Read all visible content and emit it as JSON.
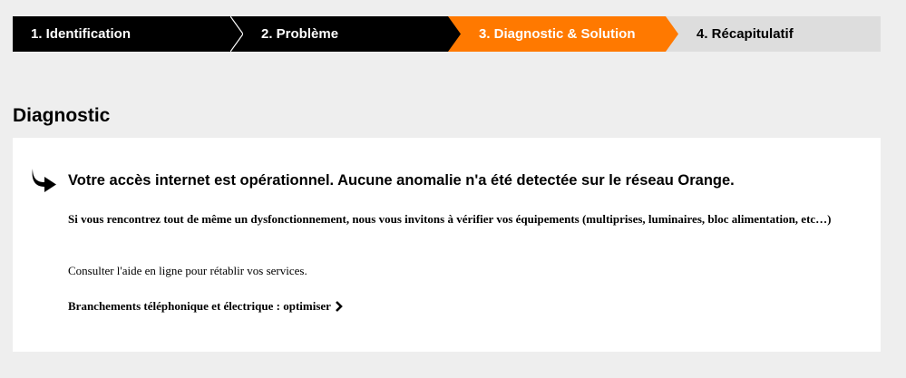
{
  "stepper": {
    "steps": [
      {
        "label": "1. Identification",
        "state": "done"
      },
      {
        "label": "2. Problème",
        "state": "done"
      },
      {
        "label": "3. Diagnostic & Solution",
        "state": "active"
      },
      {
        "label": "4. Récapitulatif",
        "state": "upcoming"
      }
    ]
  },
  "colors": {
    "brand_orange": "#ff7900",
    "step_done": "#000000",
    "step_upcoming": "#dddddd",
    "page_background": "#eeeeee"
  },
  "diagnostic": {
    "title": "Diagnostic",
    "icon": "curved-arrow-right-icon",
    "headline": "Votre accès internet est opérationnel. Aucune anomalie n'a été detectée sur le réseau Orange.",
    "advice": "Si vous rencontrez tout de même un dysfonctionnement, nous vous invitons à vérifier vos équipements (multiprises, luminaires, bloc alimentation, etc…)",
    "help_text": "Consulter l'aide en ligne pour rétablir vos services.",
    "link_label": "Branchements téléphonique et électrique : optimiser",
    "link_icon": "chevron-right-icon"
  }
}
